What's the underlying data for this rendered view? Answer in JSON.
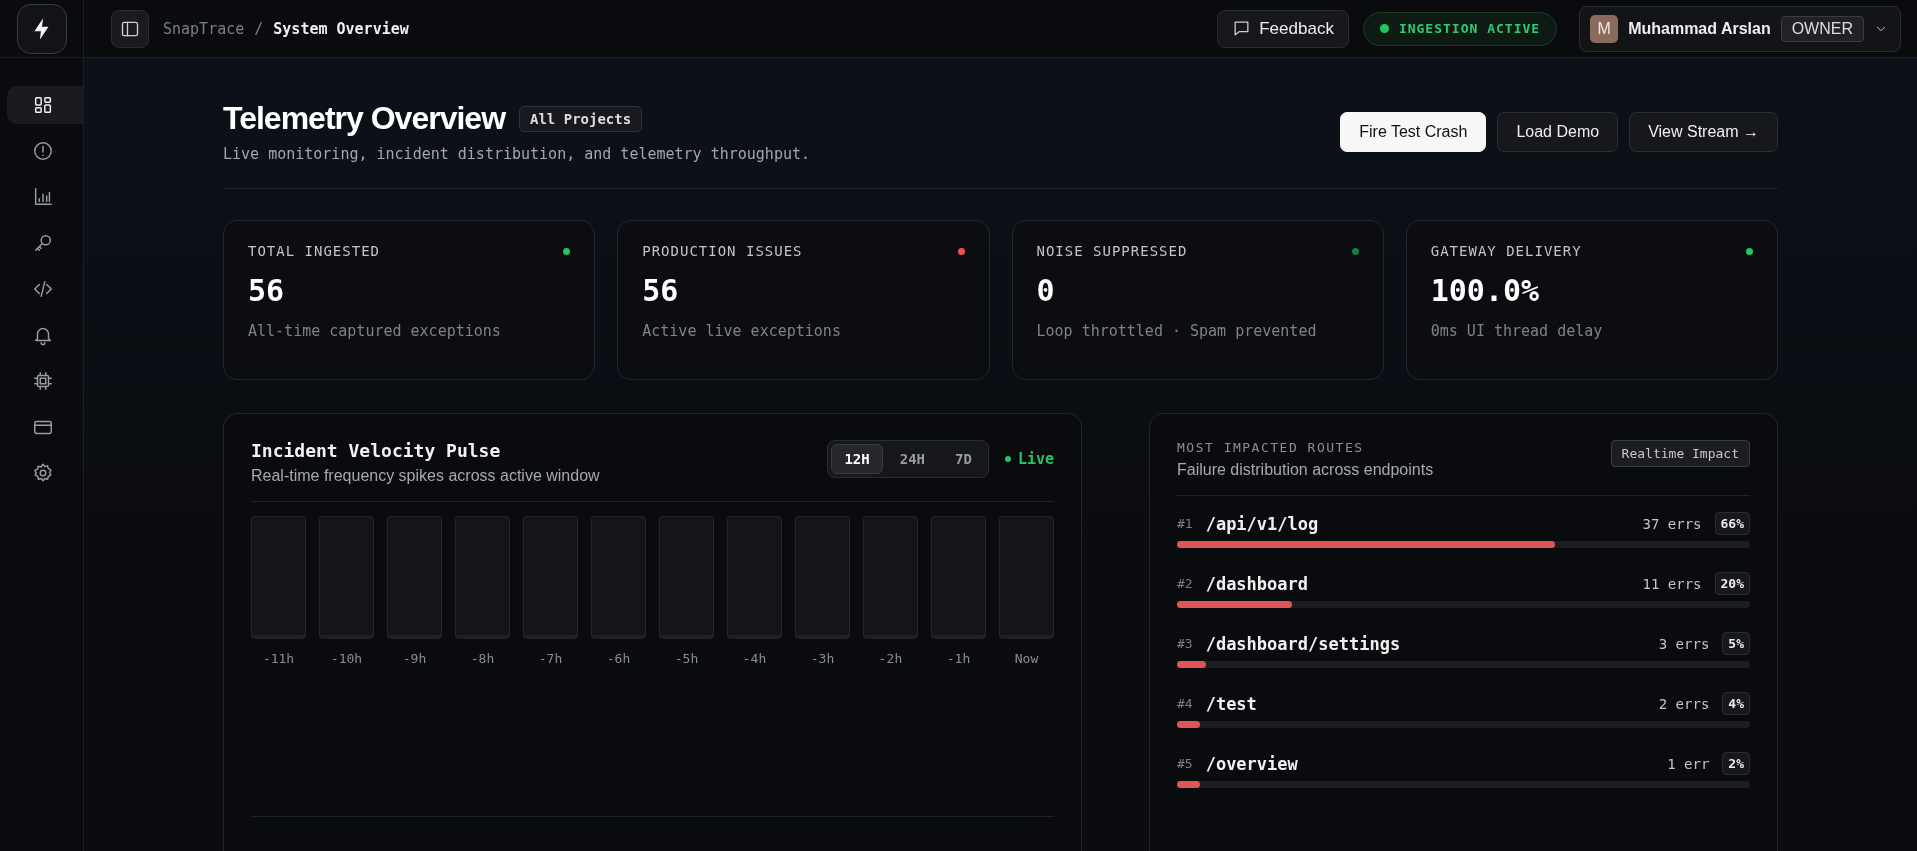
{
  "breadcrumb": {
    "project": "SnapTrace",
    "separator": "/",
    "page": "System Overview"
  },
  "topbar": {
    "feedback": "Feedback",
    "status": {
      "label": "INGESTION ACTIVE",
      "color": "#22c55e"
    },
    "user": {
      "initial": "M",
      "name": "Muhammad Arslan",
      "role": "OWNER"
    }
  },
  "sidebar": {
    "items": [
      {
        "kind": "overview",
        "selected": true
      },
      {
        "kind": "issues",
        "selected": false
      },
      {
        "kind": "analytics",
        "selected": false
      },
      {
        "kind": "keys",
        "selected": false
      },
      {
        "kind": "code",
        "selected": false
      },
      {
        "kind": "alerts",
        "selected": false
      },
      {
        "kind": "chip",
        "selected": false
      },
      {
        "kind": "billing",
        "selected": false
      },
      {
        "kind": "settings",
        "selected": false
      }
    ]
  },
  "header": {
    "title": "Telemetry Overview",
    "scope": "All Projects",
    "subtitle": "Live monitoring, incident distribution, and telemetry throughput.",
    "buttons": [
      {
        "label": "Fire Test Crash",
        "primary": true
      },
      {
        "label": "Load Demo",
        "primary": false
      },
      {
        "label": "View Stream →",
        "primary": false
      }
    ]
  },
  "stats": [
    {
      "label": "TOTAL INGESTED",
      "value": "56",
      "note": "All-time captured exceptions",
      "color": "#22c55e"
    },
    {
      "label": "PRODUCTION ISSUES",
      "value": "56",
      "note": "Active live exceptions",
      "color": "#f05252"
    },
    {
      "label": "NOISE SUPPRESSED",
      "value": "0",
      "note": "Loop throttled · Spam prevented",
      "color": "#15803d"
    },
    {
      "label": "GATEWAY DELIVERY",
      "value": "100.0%",
      "note": "0ms UI thread delay",
      "color": "#22c55e"
    }
  ],
  "pulse": {
    "title": "Incident Velocity Pulse",
    "subtitle": "Real-time frequency spikes across active window",
    "ranges": [
      {
        "label": "12H",
        "selected": true
      },
      {
        "label": "24H",
        "selected": false
      },
      {
        "label": "7D",
        "selected": false
      }
    ],
    "live": "Live",
    "slots": [
      "-11h",
      "-10h",
      "-9h",
      "-8h",
      "-7h",
      "-6h",
      "-5h",
      "-4h",
      "-3h",
      "-2h",
      "-1h",
      "Now"
    ]
  },
  "routes": {
    "heading": "MOST IMPACTED ROUTES",
    "subtitle": "Failure distribution across endpoints",
    "badge": "Realtime Impact",
    "items": [
      {
        "rank": "#1",
        "path": "/api/v1/log",
        "count": "37 errs",
        "share": "66%",
        "level": 0.66
      },
      {
        "rank": "#2",
        "path": "/dashboard",
        "count": "11 errs",
        "share": "20%",
        "level": 0.2
      },
      {
        "rank": "#3",
        "path": "/dashboard/settings",
        "count": "3 errs",
        "share": "5%",
        "level": 0.05
      },
      {
        "rank": "#4",
        "path": "/test",
        "count": "2 errs",
        "share": "4%",
        "level": 0.04
      },
      {
        "rank": "#5",
        "path": "/overview",
        "count": "1 err",
        "share": "2%",
        "level": 0.04
      }
    ]
  }
}
